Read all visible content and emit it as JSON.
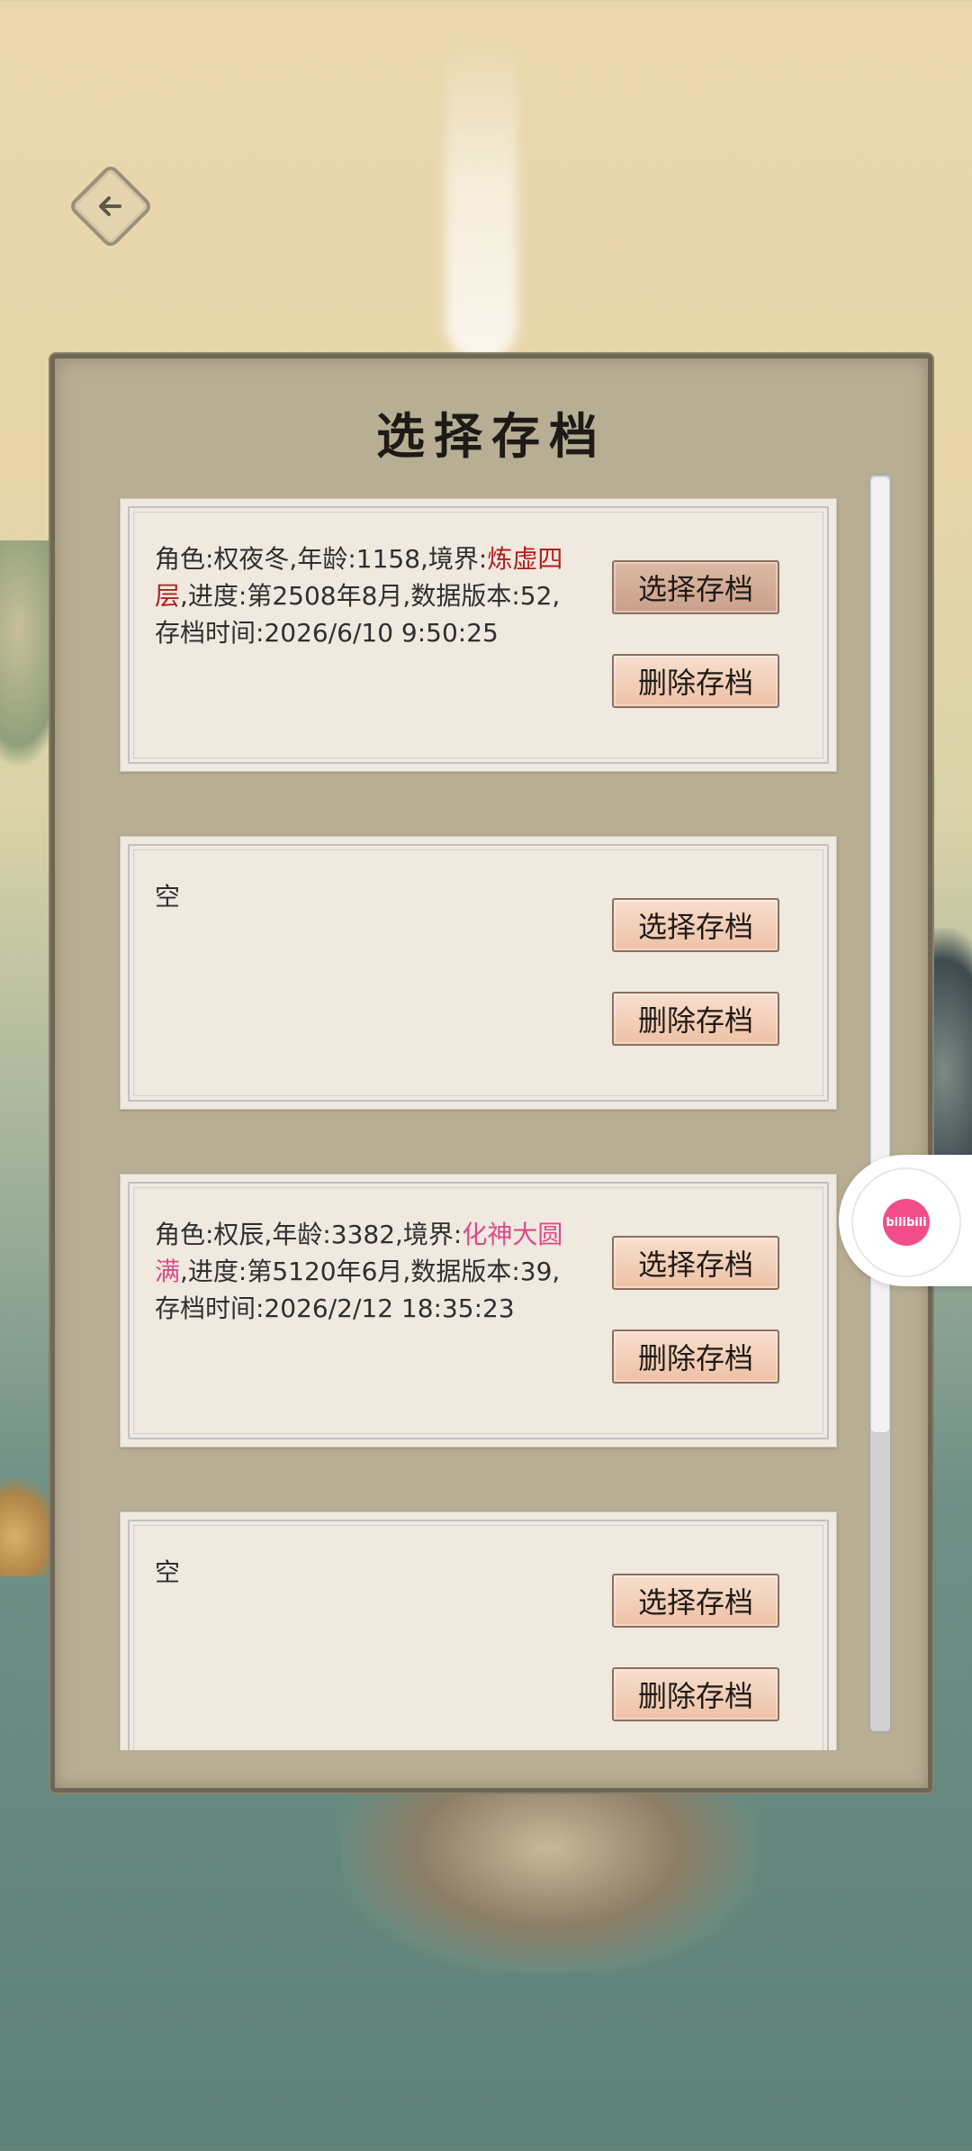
{
  "title": "选择存档",
  "slots": [
    {
      "info_prefix": "角色:权夜冬,年龄:1158,境界:",
      "realm": "炼虚四层",
      "info_suffix": ",进度:第2508年8月,数据版本:52,存档时间:2026/6/10 9:50:25",
      "realm_color": "#b21e1e",
      "select_label": "选择存档",
      "delete_label": "删除存档"
    },
    {
      "info_prefix": "空",
      "realm": "",
      "info_suffix": "",
      "select_label": "选择存档",
      "delete_label": "删除存档"
    },
    {
      "info_prefix": "角色:权辰,年龄:3382,境界:",
      "realm": "化神大圆满",
      "info_suffix": ",进度:第5120年6月,数据版本:39,存档时间:2026/2/12 18:35:23",
      "realm_color": "#d94a8c",
      "select_label": "选择存档",
      "delete_label": "删除存档"
    },
    {
      "info_prefix": "空",
      "realm": "",
      "info_suffix": "",
      "select_label": "选择存档",
      "delete_label": "删除存档"
    }
  ],
  "floating_badge": {
    "text": "bilibili",
    "color": "#f24d8a"
  },
  "icons": {
    "back": "arrow-left-icon",
    "floating": "bilibili-icon"
  }
}
